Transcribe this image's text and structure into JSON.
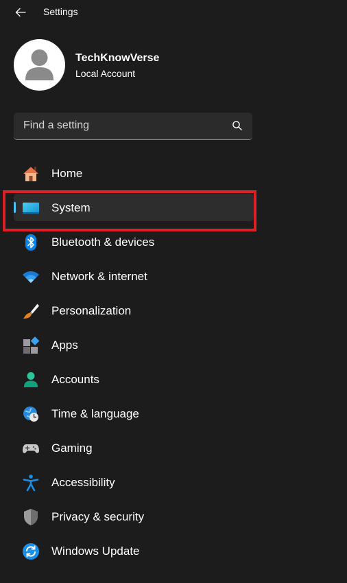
{
  "app": {
    "title": "Settings"
  },
  "profile": {
    "name": "TechKnowVerse",
    "account_type": "Local Account"
  },
  "search": {
    "placeholder": "Find a setting"
  },
  "nav": {
    "selected": "System",
    "items": [
      {
        "label": "Home",
        "icon": "home-icon"
      },
      {
        "label": "System",
        "icon": "system-icon"
      },
      {
        "label": "Bluetooth & devices",
        "icon": "bluetooth-icon"
      },
      {
        "label": "Network & internet",
        "icon": "wifi-icon"
      },
      {
        "label": "Personalization",
        "icon": "paintbrush-icon"
      },
      {
        "label": "Apps",
        "icon": "apps-icon"
      },
      {
        "label": "Accounts",
        "icon": "accounts-icon"
      },
      {
        "label": "Time & language",
        "icon": "time-language-icon"
      },
      {
        "label": "Gaming",
        "icon": "gamepad-icon"
      },
      {
        "label": "Accessibility",
        "icon": "accessibility-icon"
      },
      {
        "label": "Privacy & security",
        "icon": "shield-icon"
      },
      {
        "label": "Windows Update",
        "icon": "update-icon"
      }
    ]
  },
  "colors": {
    "background": "#1c1c1c",
    "selected_item": "#2d2d2d",
    "accent": "#4cc2ff",
    "highlight_box": "#dd1f26"
  }
}
